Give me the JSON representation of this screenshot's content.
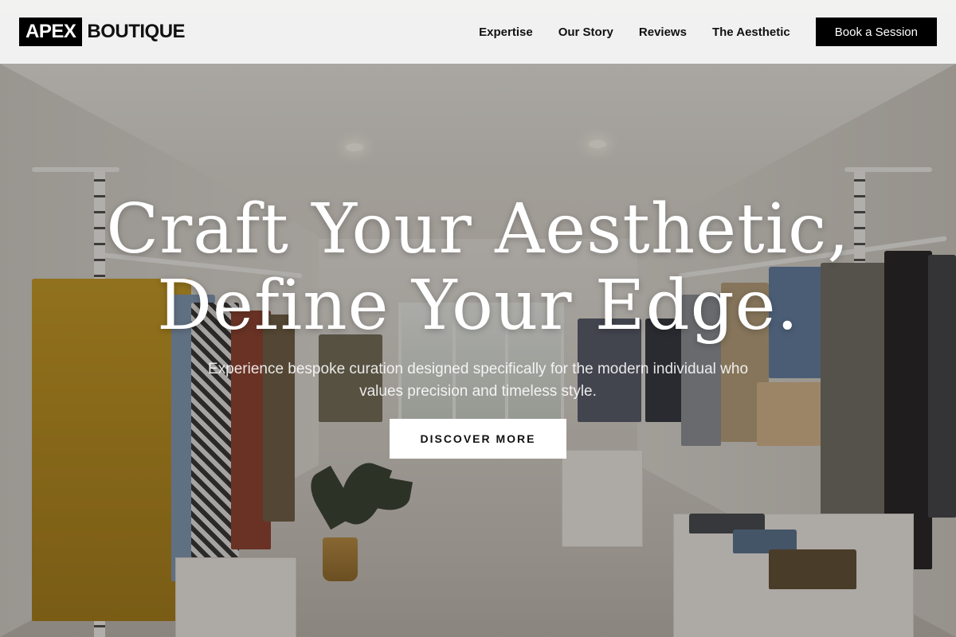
{
  "brand": {
    "logo_box_text": "APEX",
    "logo_text": "BOUTIQUE"
  },
  "nav": {
    "items": [
      {
        "label": "Expertise"
      },
      {
        "label": "Our Story"
      },
      {
        "label": "Reviews"
      },
      {
        "label": "The Aesthetic"
      }
    ],
    "cta_label": "Book a Session"
  },
  "hero": {
    "headline_line1": "Craft Your Aesthetic,",
    "headline_line2": "Define Your Edge.",
    "subtitle": "Experience bespoke curation designed specifically for the modern individual who values precision and timeless style.",
    "button_label": "DISCOVER MORE",
    "background_image": "boutique clothing store interior"
  },
  "colors": {
    "header_bg": "#f8f8f7",
    "primary": "#000000",
    "hero_text": "#ffffff"
  }
}
